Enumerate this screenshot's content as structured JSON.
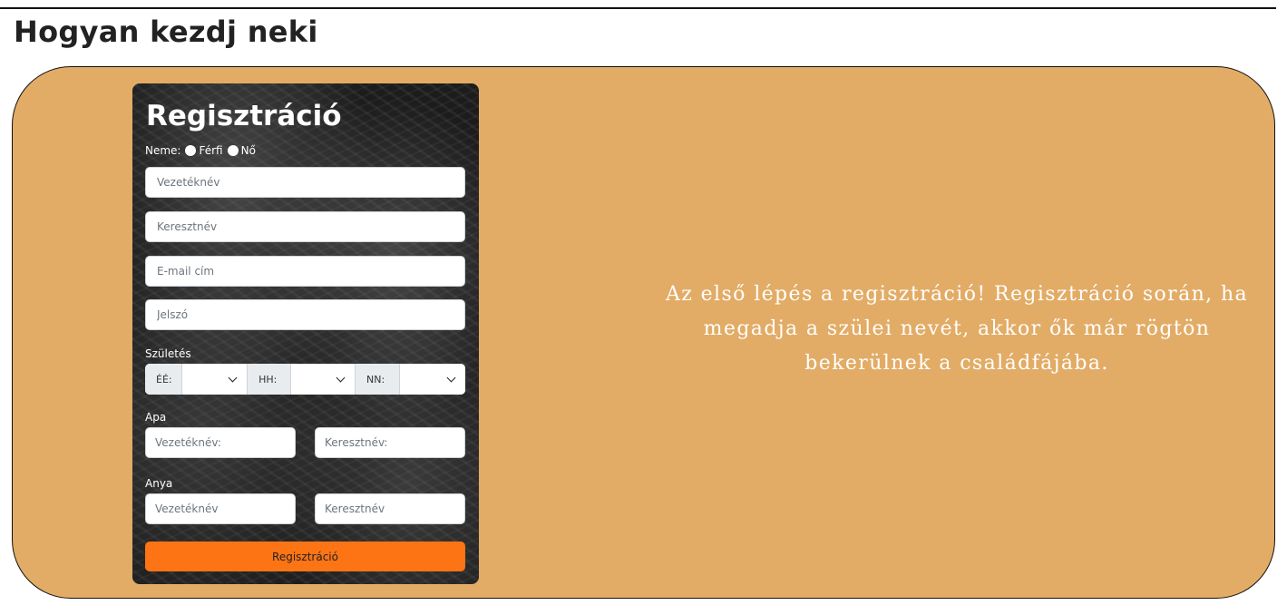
{
  "section": {
    "heading": "Hogyan kezdj neki"
  },
  "colors": {
    "panel_bg": "#e2ac66",
    "card_bg": "#1c1c1c",
    "button_bg": "#fd7415",
    "text_on_panel": "#ffffff"
  },
  "form": {
    "title": "Regisztráció",
    "gender_label": "Neme:",
    "gender_options": [
      "Férfi",
      "Nő"
    ],
    "fields": {
      "last_name_placeholder": "Vezetéknév",
      "first_name_placeholder": "Keresztnév",
      "email_placeholder": "E-mail cím",
      "password_placeholder": "Jelszó"
    },
    "birth": {
      "label": "Születés",
      "year_prefix": "ÉÉ:",
      "month_prefix": "HH:",
      "day_prefix": "NN:",
      "icon": "chevron-down-icon"
    },
    "father": {
      "label": "Apa",
      "last_name_placeholder": "Vezetéknév:",
      "first_name_placeholder": "Keresztnév:"
    },
    "mother": {
      "label": "Anya",
      "last_name_placeholder": "Vezetéknév",
      "first_name_placeholder": "Keresztnév"
    },
    "submit_label": "Regisztráció"
  },
  "intro": {
    "text": "Az első lépés a regisztráció! Regisztráció során, ha megadja a szülei nevét, akkor ők már rögtön bekerülnek a családfájába."
  }
}
